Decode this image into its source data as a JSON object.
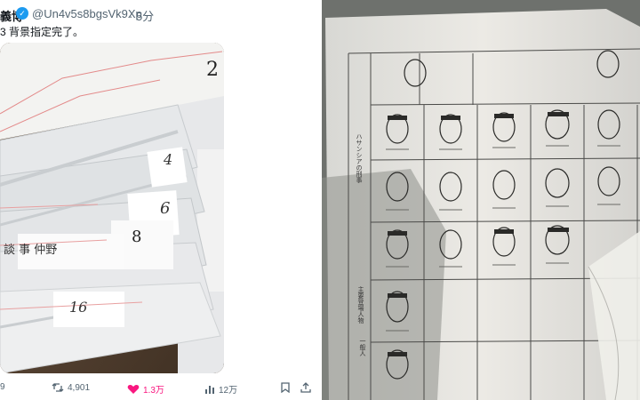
{
  "post": {
    "author_fragment": "義博",
    "handle": "@Un4v5s8bgsVk9Xp",
    "time": "· 5分",
    "text": "3 背景指定完了。"
  },
  "left_image": {
    "sheet_numbers": [
      "2",
      "4",
      "6",
      "8",
      "16"
    ],
    "handwriting": "談 事 仲野"
  },
  "right_image": {
    "left_margin": "ハサンシアの刑事",
    "row_marker": "主要登場人物",
    "mid_label": "一般人"
  },
  "actions": {
    "reply": "9",
    "repost": "4,901",
    "like": "1.3万",
    "views": "12万"
  },
  "colors": {
    "like": "#f91880",
    "verified": "#1d9bf0",
    "muted": "#536471"
  }
}
